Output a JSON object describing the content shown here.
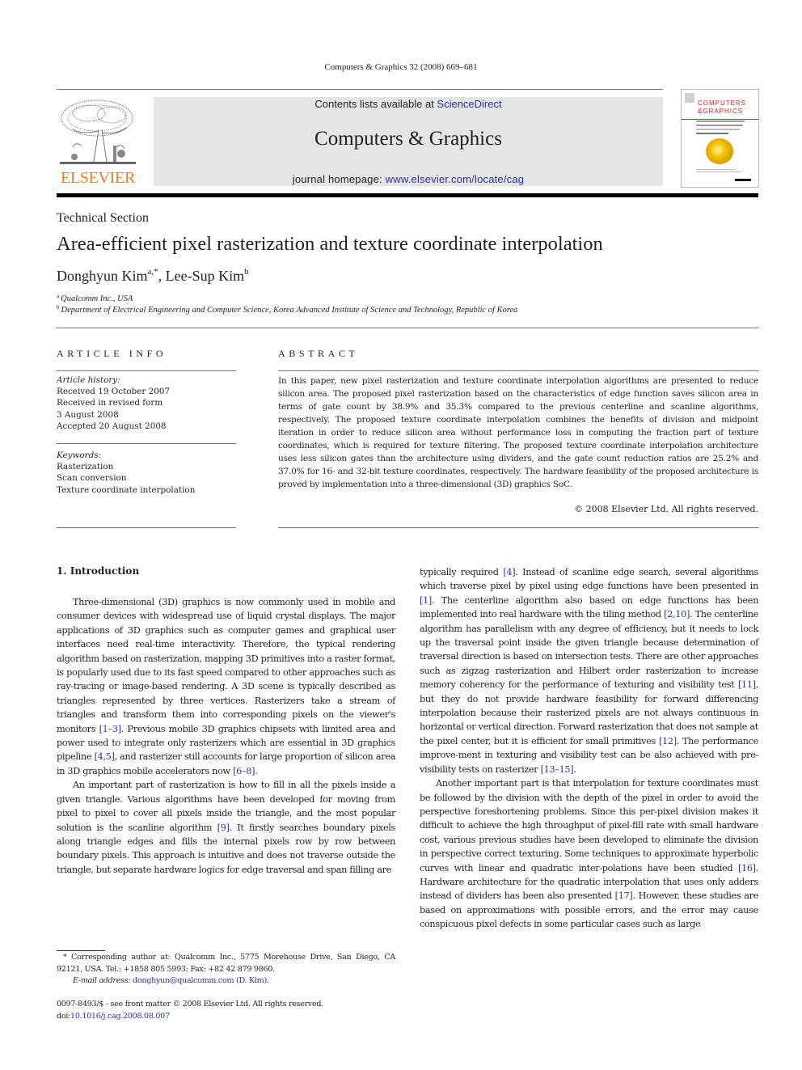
{
  "running_head": "Computers & Graphics 32 (2008) 669–681",
  "header": {
    "publisher_logo_text": "ELSEVIER",
    "contents_prefix": "Contents lists available at ",
    "contents_link": "ScienceDirect",
    "journal_title": "Computers & Graphics",
    "homepage_prefix": "journal homepage: ",
    "homepage_link": "www.elsevier.com/locate/cag",
    "cover_title_line1": "COMPUTERS",
    "cover_title_line2": "&GRAPHICS",
    "colors": {
      "logo_orange": "#f47b20",
      "link_blue": "#2e3192",
      "banner_gray": "#e5e5e5",
      "cover_red": "#d2232a"
    }
  },
  "article": {
    "section": "Technical Section",
    "title": "Area-efficient pixel rasterization and texture coordinate interpolation",
    "authors": [
      {
        "name": "Donghyun Kim",
        "marks": "a,*"
      },
      {
        "name": "Lee-Sup Kim",
        "marks": "b"
      }
    ],
    "author_separator": ", ",
    "affiliations": [
      {
        "mark": "a",
        "text": "Qualcomm Inc., USA"
      },
      {
        "mark": "b",
        "text": "Department of Electrical Engineering and Computer Science, Korea Advanced Institute of Science and Technology, Republic of Korea"
      }
    ]
  },
  "article_info": {
    "heading": "ARTICLE INFO",
    "history_label": "Article history:",
    "history": [
      "Received 19 October 2007",
      "Received in revised form",
      "3 August 2008",
      "Accepted 20 August 2008"
    ],
    "keywords_label": "Keywords:",
    "keywords": [
      "Rasterization",
      "Scan conversion",
      "Texture coordinate interpolation"
    ]
  },
  "abstract": {
    "heading": "ABSTRACT",
    "text": "In this paper, new pixel rasterization and texture coordinate interpolation algorithms are presented to reduce silicon area. The proposed pixel rasterization based on the characteristics of edge function saves silicon area in terms of gate count by 38.9% and 35.3% compared to the previous centerline and scanline algorithms, respectively. The proposed texture coordinate interpolation combines the benefits of division and midpoint iteration in order to reduce silicon area without performance loss in computing the fraction part of texture coordinates, which is required for texture filtering. The proposed texture coordinate interpolation architecture uses less silicon gates than the architecture using dividers, and the gate count reduction ratios are 25.2% and 37.0% for 16- and 32-bit texture coordinates, respectively. The hardware feasibility of the proposed architecture is proved by implementation into a three-dimensional (3D) graphics SoC.",
    "copyright": "© 2008 Elsevier Ltd. All rights reserved."
  },
  "body": {
    "section_heading": "1.  Introduction",
    "left_col": [
      {
        "segments": [
          {
            "t": "Three-dimensional (3D) graphics is now commonly used in mobile and consumer devices with widespread use of liquid crystal displays. The major applications of 3D graphics such as computer games and graphical user interfaces need real-time interactivity. Therefore, the typical rendering algorithm based on rasterization, mapping 3D primitives into a raster format, is popularly used due to its fast speed compared to other approaches such as ray-tracing or image-based rendering. A 3D scene is typically described as triangles represented by three vertices. Rasterizers take a stream of triangles and transform them into corresponding pixels on the viewer's monitors "
          },
          {
            "ref": "[1–3]"
          },
          {
            "t": ". Previous mobile 3D graphics chipsets with limited area and power used to integrate only rasterizers which are essential in 3D graphics pipeline "
          },
          {
            "ref": "[4,5]"
          },
          {
            "t": ", and rasterizer still accounts for large proportion of silicon area in 3D graphics mobile accelerators now "
          },
          {
            "ref": "[6–8]"
          },
          {
            "t": "."
          }
        ]
      },
      {
        "segments": [
          {
            "t": "An important part of rasterization is how to fill in all the pixels inside a given triangle. Various algorithms have been developed for moving from pixel to pixel to cover all pixels inside the triangle, and the most popular solution is the scanline algorithm "
          },
          {
            "ref": "[9]"
          },
          {
            "t": ". It firstly searches boundary pixels along triangle edges and fills the internal pixels row by row between boundary pixels. This approach is intuitive and does not traverse outside the triangle, but separate hardware logics for edge traversal and span filling are"
          }
        ]
      }
    ],
    "right_col": [
      {
        "noindent": true,
        "segments": [
          {
            "t": "typically required "
          },
          {
            "ref": "[4]"
          },
          {
            "t": ". Instead of scanline edge search, several algorithms which traverse pixel by pixel using edge functions have been presented in "
          },
          {
            "ref": "[1]"
          },
          {
            "t": ". The centerline algorithm also based on edge functions has been implemented into real hardware with the tiling method "
          },
          {
            "ref": "[2,10]"
          },
          {
            "t": ". The centerline algorithm has parallelism with any degree of efficiency, but it needs to lock up the traversal point inside the given triangle because determination of traversal direction is based on intersection tests. There are other approaches such as zigzag rasterization and Hilbert order rasterization to increase memory coherency for the performance of texturing and visibility test "
          },
          {
            "ref": "[11]"
          },
          {
            "t": ", but they do not provide hardware feasibility for forward differencing interpolation because their rasterized pixels are not always continuous in horizontal or vertical direction. Forward rasterization that does not sample at the pixel center, but it is efficient for small primitives "
          },
          {
            "ref": "[12]"
          },
          {
            "t": ". The performance improve-ment in texturing and visibility test can be also achieved with pre-visibility tests on rasterizer "
          },
          {
            "ref": "[13–15]"
          },
          {
            "t": "."
          }
        ]
      },
      {
        "segments": [
          {
            "t": "Another important part is that interpolation for texture coordinates must be followed by the division with the depth of the pixel in order to avoid the perspective foreshortening problems. Since this per-pixel division makes it difficult to achieve the high throughput of pixel-fill rate with small hardware cost, various previous studies have been developed to eliminate the division in perspective correct texturing. Some techniques to approximate hyperbolic curves with linear and quadratic inter-polations have been studied "
          },
          {
            "ref": "[16]"
          },
          {
            "t": ". Hardware architecture for the quadratic interpolation that uses only adders instead of dividers has been also presented "
          },
          {
            "ref": "[17]"
          },
          {
            "t": ". However, these studies are based on approximations with possible errors, and the error may cause conspicuous pixel defects in some particular cases such as large"
          }
        ]
      }
    ]
  },
  "footnotes": {
    "corresponding": "* Corresponding author at: Qualcomm Inc., 5775 Morehouse Drive, San Diego, CA 92121, USA. Tel.: +1858 805 5993; Fax: +82 42 879 9860.",
    "email_label": "E-mail address: ",
    "email_link": "donghyun@qualcomm.com (D. Kim).",
    "issn_line": "0097-8493/$ - see front matter © 2008 Elsevier Ltd. All rights reserved.",
    "doi_prefix": "doi:",
    "doi_link": "10.1016/j.cag.2008.08.007"
  }
}
